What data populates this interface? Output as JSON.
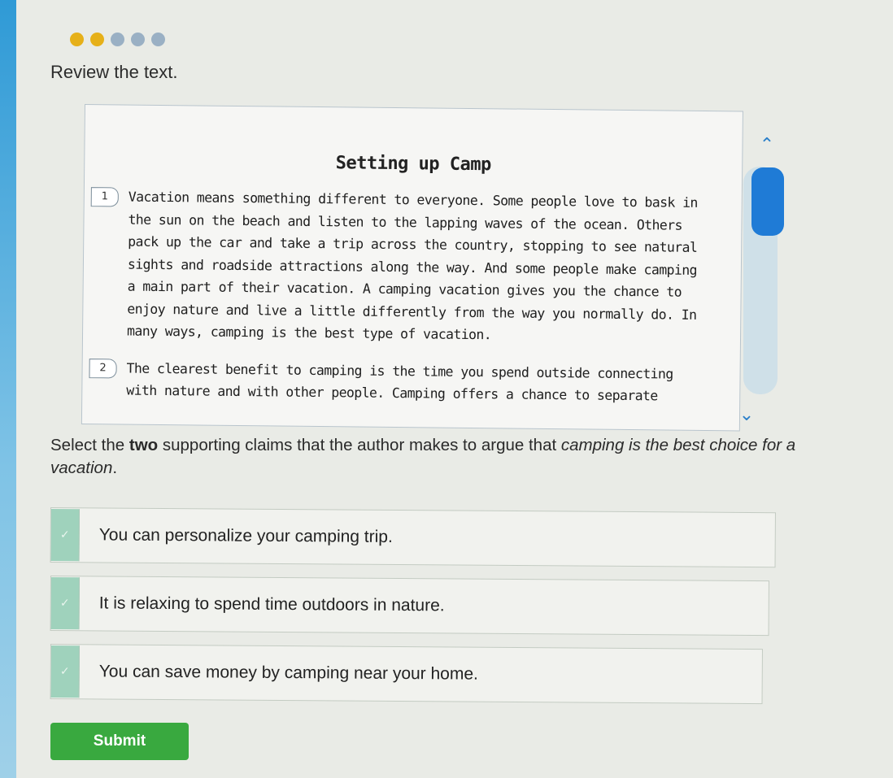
{
  "header": {
    "review_title": "Review the text."
  },
  "progress": {
    "total": 5,
    "completed": 2
  },
  "passage": {
    "title": "Setting up Camp",
    "paragraphs": [
      {
        "number": "1",
        "text": "Vacation means something different to everyone. Some people love to bask in the sun on the beach and listen to the lapping waves of the ocean. Others pack up the car and take a trip across the country, stopping to see natural sights and roadside attractions along the way. And some people make camping a main part of their vacation. A camping vacation gives you the chance to enjoy nature and live a little differently from the way you normally do. In many ways, camping is the best type of vacation."
      },
      {
        "number": "2",
        "text": "The clearest benefit to camping is the time you spend outside connecting with nature and with other people. Camping offers a chance to separate"
      }
    ]
  },
  "question": {
    "part1": "Select the ",
    "bold": "two",
    "part2": " supporting claims that the author makes to argue that ",
    "italic": "camping is the best choice for a vacation",
    "part3": "."
  },
  "options": [
    {
      "label": "You can personalize your camping trip."
    },
    {
      "label": "It is relaxing to spend time outdoors in nature."
    },
    {
      "label": "You can save money by camping near your home."
    }
  ],
  "submit": {
    "label": "Submit"
  },
  "colors": {
    "submit": "#39a93f",
    "scroll_thumb": "#1f7bd6",
    "progress_done": "#e6b019",
    "progress_pending": "#9ab0c4"
  }
}
